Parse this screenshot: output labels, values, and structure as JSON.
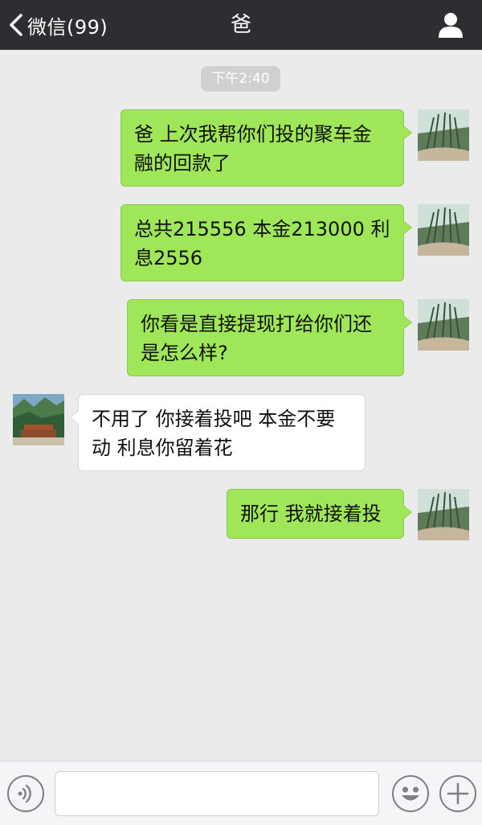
{
  "header": {
    "back_label": "微信(99)",
    "title": "爸"
  },
  "chat": {
    "timestamp": "下午2:40",
    "messages": [
      {
        "from": "me",
        "lines": [
          "爸 上次我帮你们投的聚车金",
          "融的回款了"
        ]
      },
      {
        "from": "me",
        "lines": [
          "总共215556 本金213000 利",
          "息2556"
        ]
      },
      {
        "from": "me",
        "lines": [
          "你看是直接提现打给你们还",
          "是怎么样?"
        ]
      },
      {
        "from": "dad",
        "lines": [
          "不用了 你接着投吧 本金不要",
          "动 利息你留着花"
        ]
      },
      {
        "from": "me",
        "lines": [
          "那行 我就接着投"
        ]
      }
    ]
  },
  "input_bar": {
    "message_value": "",
    "voice_icon": "voice-icon",
    "emoji_icon": "emoji-icon",
    "plus_icon": "plus-icon"
  },
  "colors": {
    "header_bg": "#2d2d32",
    "chat_bg": "#ebebeb",
    "outgoing_bubble": "#9fe658",
    "incoming_bubble": "#ffffff",
    "timestamp_bg": "#d0d0d0"
  }
}
